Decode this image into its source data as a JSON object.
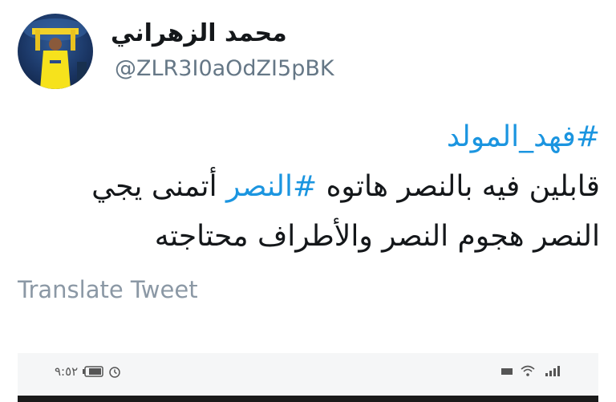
{
  "author": {
    "display_name": "محمد الزهراني",
    "handle": "@ZLR3I0aOdZI5pBK"
  },
  "tweet": {
    "line1": "#فهد_المولد",
    "line2_part1": "قابلين فيه بالنصر هاتوه ",
    "line2_hashtag": "#النصر",
    "line2_part2": " أتمنى يجي",
    "line3": "النصر هجوم النصر والأطراف محتاجته"
  },
  "translate_label": "Translate Tweet",
  "media": {
    "status_time": "٩:٥٢",
    "icons": [
      "alarm-icon",
      "battery-icon",
      "wifi-icon",
      "signal-icon"
    ]
  },
  "colors": {
    "hashtag": "#1b95e0",
    "name": "#14171a",
    "secondary": "#657786"
  }
}
